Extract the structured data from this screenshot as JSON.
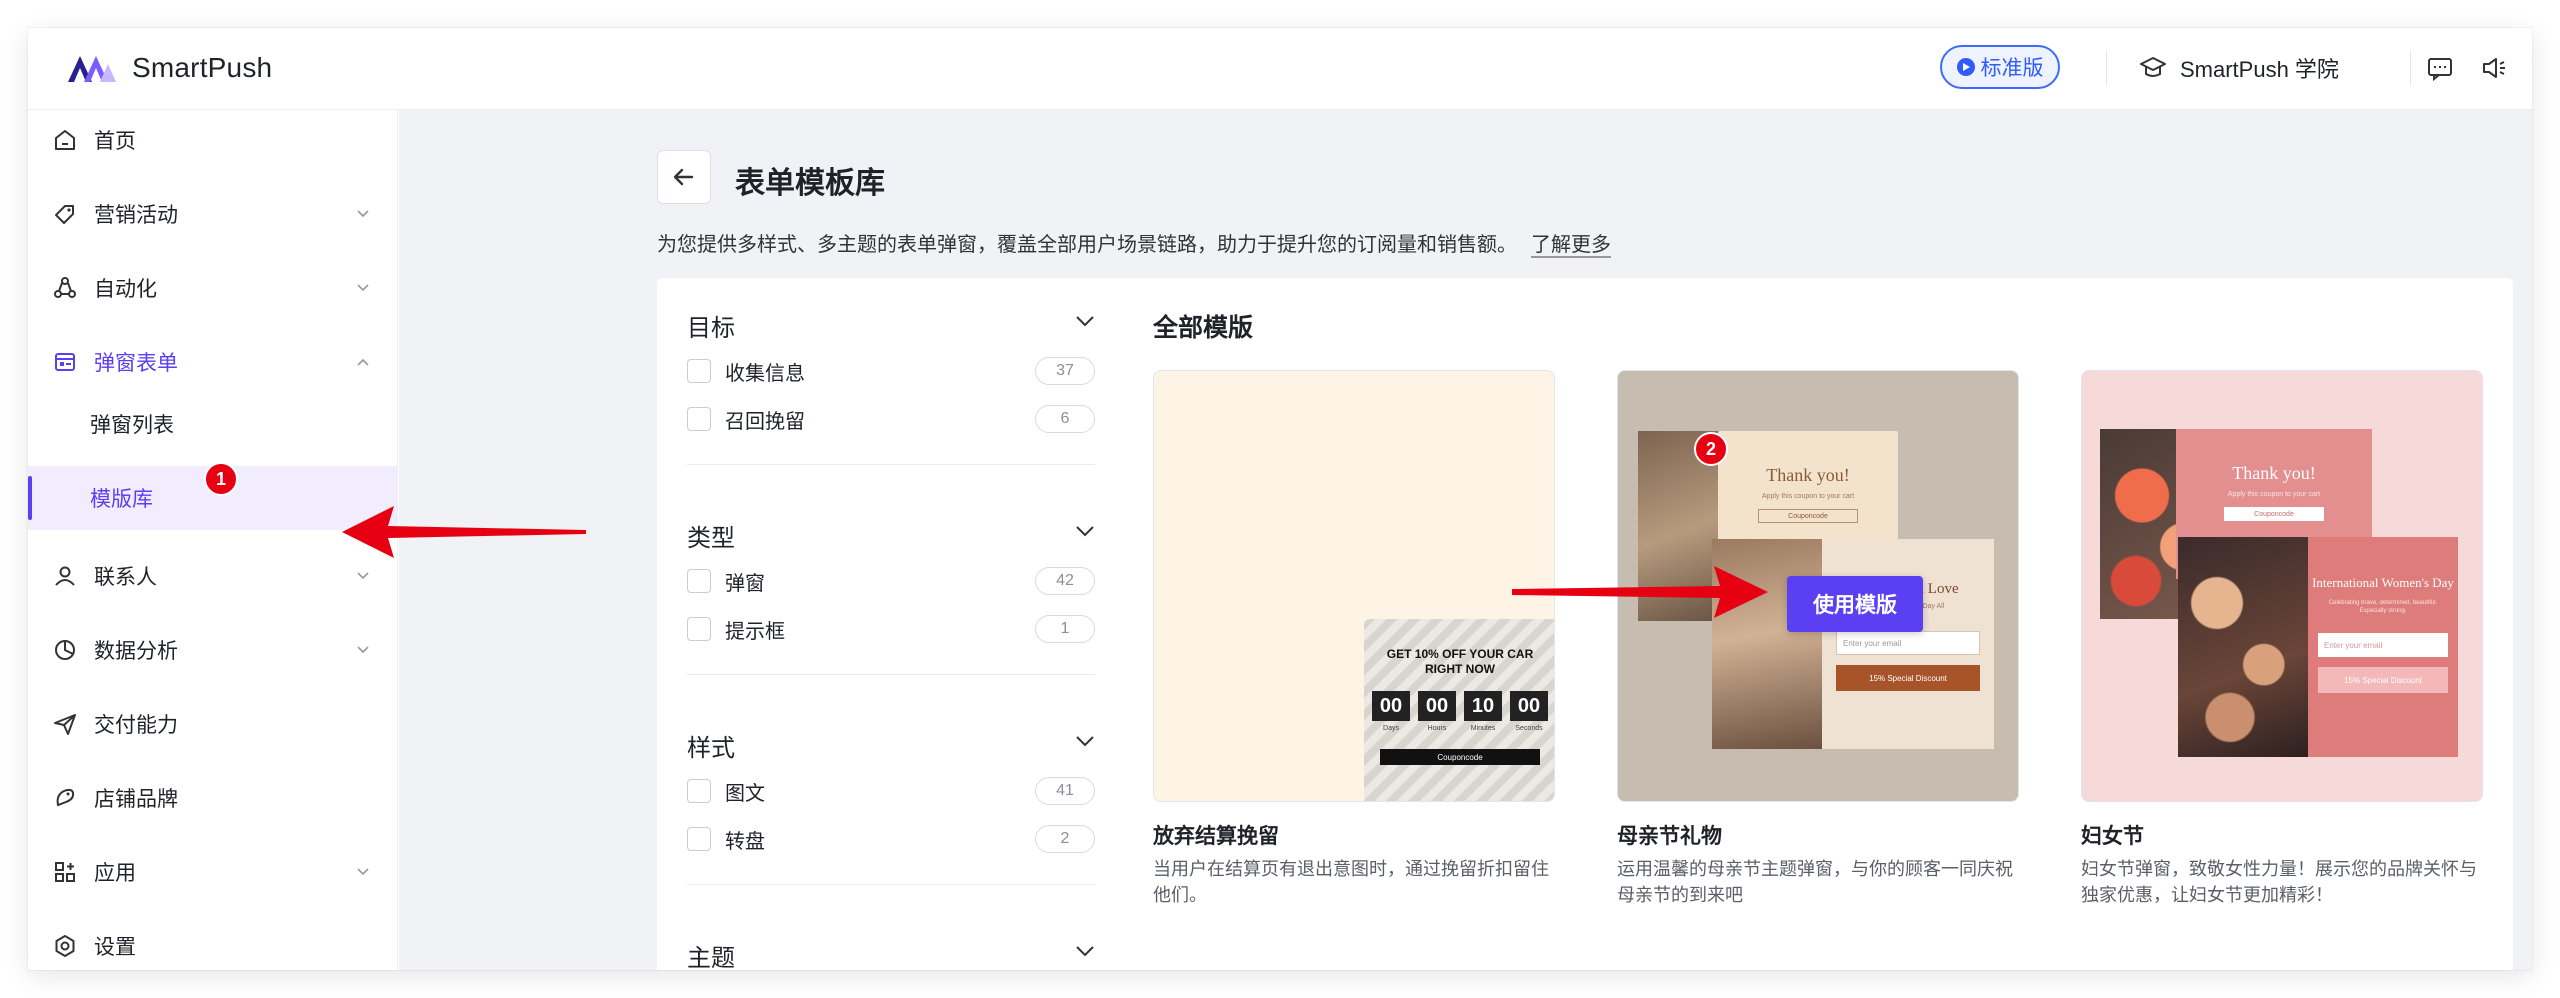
{
  "app": {
    "name": "SmartPush"
  },
  "header": {
    "plan_badge": "标准版",
    "academy": "SmartPush 学院",
    "icons": [
      "message-icon",
      "speaker-icon"
    ]
  },
  "sidebar": {
    "items": [
      {
        "label": "首页",
        "icon": "home-icon"
      },
      {
        "label": "营销活动",
        "icon": "tag-icon"
      },
      {
        "label": "自动化",
        "icon": "automation-icon"
      },
      {
        "label": "弹窗表单",
        "icon": "form-icon"
      },
      {
        "label": "弹窗列表"
      },
      {
        "label": "模版库"
      },
      {
        "label": "联系人",
        "icon": "user-icon"
      },
      {
        "label": "数据分析",
        "icon": "pie-chart-icon"
      },
      {
        "label": "交付能力",
        "icon": "send-icon"
      },
      {
        "label": "店铺品牌",
        "icon": "brand-icon"
      },
      {
        "label": "应用",
        "icon": "apps-icon"
      },
      {
        "label": "设置",
        "icon": "settings-icon"
      }
    ]
  },
  "annotations": {
    "step1": "1",
    "step2": "2"
  },
  "page": {
    "title": "表单模板库",
    "description": "为您提供多样式、多主题的表单弹窗，覆盖全部用户场景链路，助力于提升您的订阅量和销售额。",
    "learn_more": "了解更多"
  },
  "filters": [
    {
      "title": "目标",
      "options": [
        {
          "label": "收集信息",
          "count": "37"
        },
        {
          "label": "召回挽留",
          "count": "6"
        }
      ]
    },
    {
      "title": "类型",
      "options": [
        {
          "label": "弹窗",
          "count": "42"
        },
        {
          "label": "提示框",
          "count": "1"
        }
      ]
    },
    {
      "title": "样式",
      "options": [
        {
          "label": "图文",
          "count": "41"
        },
        {
          "label": "转盘",
          "count": "2"
        }
      ]
    },
    {
      "title": "主题",
      "options": []
    }
  ],
  "templates": {
    "section_title": "全部模版",
    "use_button": "使用模版",
    "items": [
      {
        "name": "放弃结算挽留",
        "description": "当用户在结算页有退出意图时，通过挽留折扣留住他们。",
        "preview": {
          "headline": "GET 10% OFF YOUR CAR RIGHT NOW",
          "timer": [
            "00",
            "00",
            "10",
            "00"
          ],
          "timer_units": [
            "Days",
            "Hours",
            "Minutes",
            "Seconds"
          ],
          "button": "Couponcode"
        }
      },
      {
        "name": "母亲节礼物",
        "description": "运用温馨的母亲节主题弹窗，与你的顾客一同庆祝母亲节的到来吧",
        "preview": {
          "headline": "Thank you!",
          "subline": "Apply this coupon to your cart",
          "code": "Couponcode",
          "card_title": "Mom, with Love",
          "card_sub": "Happy Mother's Day All",
          "input": "Enter your email",
          "button": "15% Special Discount"
        }
      },
      {
        "name": "妇女节",
        "description": "妇女节弹窗，致敬女性力量！展示您的品牌关怀与独家优惠，让妇女节更加精彩！",
        "preview": {
          "headline": "Thank you!",
          "subline": "Apply this coupon to your cart",
          "code": "Couponcode",
          "card_title": "International Women's Day",
          "card_sub": "Celebrating brave, determined, beautiful. Especially strong.",
          "input": "Enter your email",
          "button": "15% Special Discount"
        }
      }
    ]
  },
  "colors": {
    "primary": "#5b3ff2",
    "badge_red": "#e60012",
    "plan_blue": "#2f5bff"
  }
}
